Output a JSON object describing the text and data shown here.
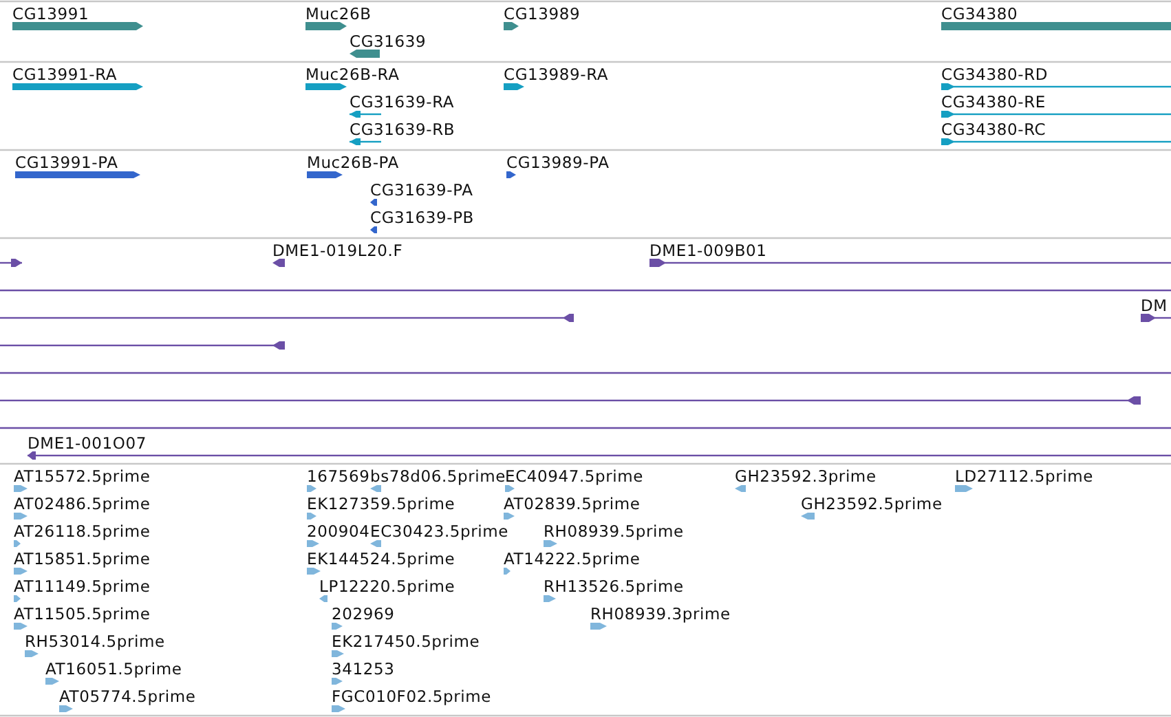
{
  "tracks": [
    {
      "kind": "gene",
      "features": [
        {
          "label": "CG13991",
          "reverse": false
        },
        {
          "label": "Muc26B",
          "reverse": false
        },
        {
          "label": "CG31639",
          "reverse": true
        },
        {
          "label": "CG13989",
          "reverse": false
        },
        {
          "label": "CG34380",
          "reverse": false
        }
      ]
    },
    {
      "kind": "transcript",
      "features": [
        {
          "label": "CG13991-RA",
          "reverse": false
        },
        {
          "label": "Muc26B-RA",
          "reverse": false
        },
        {
          "label": "CG31639-RA",
          "reverse": true
        },
        {
          "label": "CG31639-RB",
          "reverse": true
        },
        {
          "label": "CG13989-RA",
          "reverse": false
        },
        {
          "label": "CG34380-RD",
          "reverse": false
        },
        {
          "label": "CG34380-RE",
          "reverse": false
        },
        {
          "label": "CG34380-RC",
          "reverse": false
        }
      ]
    },
    {
      "kind": "protein",
      "features": [
        {
          "label": "CG13991-PA",
          "reverse": false
        },
        {
          "label": "Muc26B-PA",
          "reverse": false
        },
        {
          "label": "CG31639-PA",
          "reverse": true
        },
        {
          "label": "CG31639-PB",
          "reverse": true
        },
        {
          "label": "CG13989-PA",
          "reverse": false
        }
      ]
    },
    {
      "kind": "clone",
      "features": [
        {
          "kind": "read",
          "reverse": false
        },
        {
          "kind": "read",
          "label": "DME1-019L20.F",
          "reverse": true
        },
        {
          "kind": "read",
          "label": "DME1-009B01",
          "reverse": false
        },
        {
          "kind": "span"
        },
        {
          "kind": "read",
          "reverse": true
        },
        {
          "kind": "read",
          "label": "DM",
          "reverse": false
        },
        {
          "kind": "read",
          "reverse": true
        },
        {
          "kind": "span"
        },
        {
          "kind": "read",
          "reverse": true
        },
        {
          "kind": "span"
        },
        {
          "kind": "read",
          "label": "DME1-001O07",
          "reverse": true
        }
      ]
    },
    {
      "kind": "est",
      "features": [
        {
          "label": "AT15572.5prime",
          "reverse": false
        },
        {
          "label": "AT02486.5prime",
          "reverse": false
        },
        {
          "label": "AT26118.5prime",
          "reverse": false
        },
        {
          "label": "AT15851.5prime",
          "reverse": false
        },
        {
          "label": "AT11149.5prime",
          "reverse": false
        },
        {
          "label": "AT11505.5prime",
          "reverse": false
        },
        {
          "label": "RH53014.5prime",
          "reverse": false
        },
        {
          "label": "AT16051.5prime",
          "reverse": false
        },
        {
          "label": "AT05774.5prime",
          "reverse": false
        },
        {
          "label": "167569",
          "reverse": false
        },
        {
          "label": "bs78d06.5prime",
          "reverse": true
        },
        {
          "label": "EC40947.5prime",
          "reverse": false
        },
        {
          "label": "EK127359.5prime",
          "reverse": false
        },
        {
          "label": "AT02839.5prime",
          "reverse": false
        },
        {
          "label": "200904",
          "reverse": false
        },
        {
          "label": "EC30423.5prime",
          "reverse": true
        },
        {
          "label": "RH08939.5prime",
          "reverse": false
        },
        {
          "label": "EK144524.5prime",
          "reverse": false
        },
        {
          "label": "AT14222.5prime",
          "reverse": false
        },
        {
          "label": "LP12220.5prime",
          "reverse": true
        },
        {
          "label": "RH13526.5prime",
          "reverse": false
        },
        {
          "label": "202969",
          "reverse": false
        },
        {
          "label": "RH08939.3prime",
          "reverse": false
        },
        {
          "label": "EK217450.5prime",
          "reverse": false
        },
        {
          "label": "341253",
          "reverse": false
        },
        {
          "label": "FGC010F02.5prime",
          "reverse": false
        },
        {
          "label": "GH23592.3prime",
          "reverse": true
        },
        {
          "label": "GH23592.5prime",
          "reverse": true
        },
        {
          "label": "LD27112.5prime",
          "reverse": false
        }
      ]
    }
  ]
}
